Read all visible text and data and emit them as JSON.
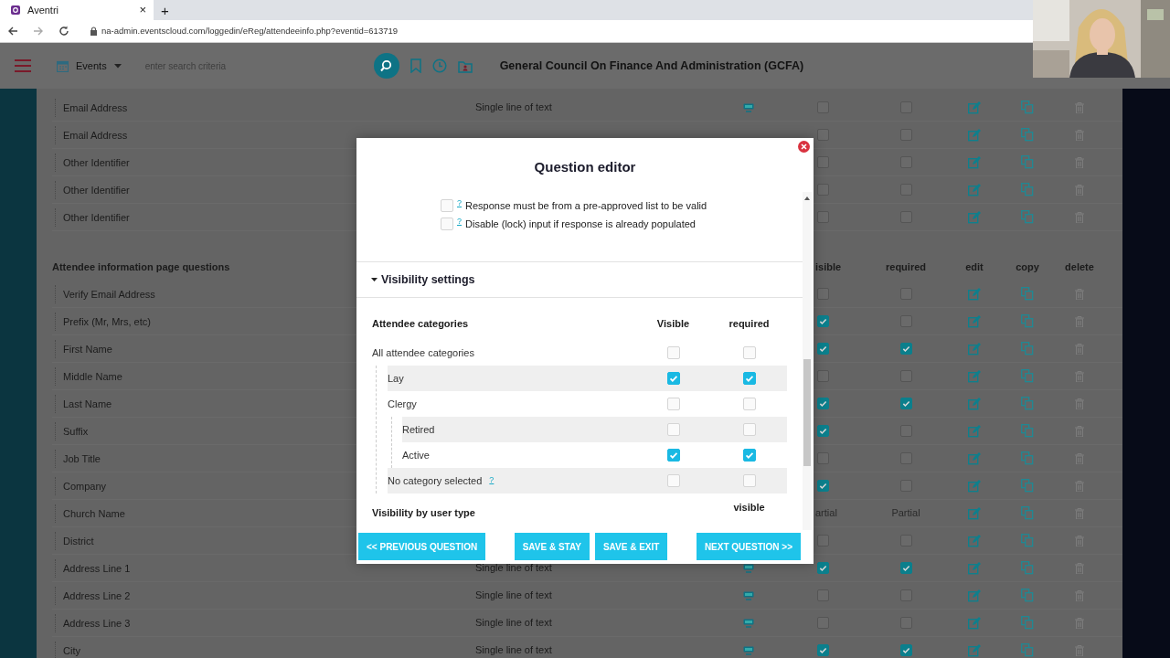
{
  "browser": {
    "tab_title": "Aventri",
    "tab_close": "×",
    "new_tab": "+",
    "url": "na-admin.eventscloud.com/loggedin/eReg/attendeeinfo.php?eventid=613719"
  },
  "header": {
    "module": "Events",
    "search_placeholder": "enter search criteria",
    "org_title": "General Council On Finance And Administration (GCFA)"
  },
  "table": {
    "top_rows": [
      {
        "label": "Email Address",
        "type": "Single line of text",
        "kind": "checkbox",
        "visible": false,
        "required": false
      },
      {
        "label": "Email Address",
        "kind": "checkbox",
        "visible": false,
        "required": false
      },
      {
        "label": "Other Identifier",
        "kind": "checkbox",
        "visible": false,
        "required": false
      },
      {
        "label": "Other Identifier",
        "kind": "checkbox",
        "visible": false,
        "required": false
      },
      {
        "label": "Other Identifier",
        "kind": "checkbox",
        "visible": false,
        "required": false
      }
    ],
    "section_title": "Attendee information page questions",
    "columns": [
      "isible",
      "required",
      "edit",
      "copy",
      "delete"
    ],
    "rows": [
      {
        "label": "Verify Email Address",
        "kind": "checkbox",
        "visible": false,
        "required": false
      },
      {
        "label": "Prefix (Mr, Mrs, etc)",
        "kind": "checkbox",
        "visible": true,
        "required": false
      },
      {
        "label": "First Name",
        "kind": "checkbox",
        "visible": true,
        "required": true
      },
      {
        "label": "Middle Name",
        "kind": "checkbox",
        "visible": false,
        "required": false
      },
      {
        "label": "Last Name",
        "kind": "checkbox",
        "visible": true,
        "required": true
      },
      {
        "label": "Suffix",
        "kind": "checkbox",
        "visible": true,
        "required": false
      },
      {
        "label": "Job Title",
        "kind": "checkbox",
        "visible": false,
        "required": false
      },
      {
        "label": "Company",
        "kind": "checkbox",
        "visible": true,
        "required": false
      },
      {
        "label": "Church Name",
        "kind": "partial",
        "visible_text": "artial",
        "required_text": "Partial"
      },
      {
        "label": "District",
        "kind": "checkbox",
        "visible": false,
        "required": false
      },
      {
        "label": "Address Line 1",
        "type": "Single line of text",
        "kind": "checkbox",
        "visible": true,
        "required": true
      },
      {
        "label": "Address Line 2",
        "type": "Single line of text",
        "kind": "checkbox",
        "visible": false,
        "required": false
      },
      {
        "label": "Address Line 3",
        "type": "Single line of text",
        "kind": "checkbox",
        "visible": false,
        "required": false
      },
      {
        "label": "City",
        "type": "Single line of text",
        "kind": "checkbox",
        "visible": true,
        "required": true
      }
    ]
  },
  "modal": {
    "title": "Question editor",
    "options": [
      {
        "help": "?",
        "label": "Response must be from a pre-approved list to be valid",
        "checked": false
      },
      {
        "help": "?",
        "label": "Disable (lock) input if response is already populated",
        "checked": false
      }
    ],
    "section_title": "Visibility settings",
    "expanded": true,
    "categories_heading": "Attendee categories",
    "columns": [
      "Visible",
      "required"
    ],
    "categories": [
      {
        "label": "All attendee categories",
        "visible": false,
        "required": false,
        "children": [
          {
            "label": "Lay",
            "visible": true,
            "required": true
          },
          {
            "label": "Clergy",
            "visible": false,
            "required": false,
            "children": [
              {
                "label": "Retired",
                "visible": false,
                "required": false
              },
              {
                "label": "Active",
                "visible": true,
                "required": true
              }
            ]
          },
          {
            "label": "No category selected",
            "help": "?",
            "visible": false,
            "required": false
          }
        ]
      }
    ],
    "user_type_heading": "Visibility by user type",
    "user_type_column": "visible",
    "buttons": [
      {
        "label": "<< PREVIOUS QUESTION"
      },
      {
        "label": "SAVE & STAY"
      },
      {
        "label": "SAVE & EXIT"
      },
      {
        "label": "NEXT QUESTION >>"
      }
    ]
  }
}
